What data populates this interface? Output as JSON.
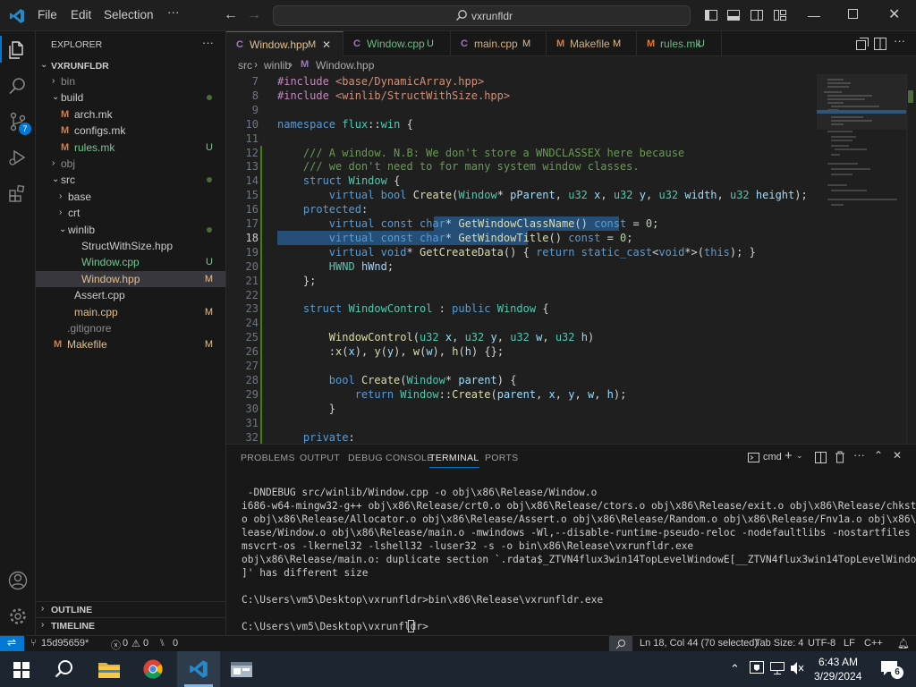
{
  "window": {
    "title": "vxrunfldr"
  },
  "menu": {
    "file": "File",
    "edit": "Edit",
    "selection": "Selection",
    "more": "···"
  },
  "sidebar": {
    "header": "EXPLORER",
    "root": "VXRUNFLDR",
    "items": [
      {
        "label": "bin",
        "status": "",
        "depth": 1,
        "kind": "folder-closed",
        "dot": false
      },
      {
        "label": "build",
        "status": "",
        "depth": 1,
        "kind": "folder-open",
        "dot": true
      },
      {
        "label": "arch.mk",
        "status": "",
        "depth": 2,
        "kind": "makefile",
        "dot": false
      },
      {
        "label": "configs.mk",
        "status": "",
        "depth": 2,
        "kind": "makefile",
        "dot": false
      },
      {
        "label": "rules.mk",
        "status": "U",
        "depth": 2,
        "kind": "makefile",
        "dot": false
      },
      {
        "label": "obj",
        "status": "",
        "depth": 1,
        "kind": "folder-closed",
        "dot": false
      },
      {
        "label": "src",
        "status": "",
        "depth": 1,
        "kind": "folder-open",
        "dot": true
      },
      {
        "label": "base",
        "status": "",
        "depth": 2,
        "kind": "folder-closed",
        "dot": false
      },
      {
        "label": "crt",
        "status": "",
        "depth": 2,
        "kind": "folder-closed",
        "dot": false
      },
      {
        "label": "winlib",
        "status": "",
        "depth": 2,
        "kind": "folder-open",
        "dot": true
      },
      {
        "label": "StructWithSize.hpp",
        "status": "",
        "depth": 3,
        "kind": "file",
        "dot": false
      },
      {
        "label": "Window.cpp",
        "status": "U",
        "depth": 3,
        "kind": "file",
        "dot": false
      },
      {
        "label": "Window.hpp",
        "status": "M",
        "depth": 3,
        "kind": "file",
        "dot": false
      },
      {
        "label": "Assert.cpp",
        "status": "",
        "depth": 2,
        "kind": "file",
        "dot": false
      },
      {
        "label": "main.cpp",
        "status": "M",
        "depth": 2,
        "kind": "file",
        "dot": false
      },
      {
        "label": ".gitignore",
        "status": "",
        "depth": 1,
        "kind": "file",
        "dot": false
      },
      {
        "label": "Makefile",
        "status": "M",
        "depth": 1,
        "kind": "makefile",
        "dot": false
      }
    ],
    "outline": "OUTLINE",
    "timeline": "TIMELINE"
  },
  "tabs": [
    {
      "label": "Window.hpp",
      "status": "M"
    },
    {
      "label": "Window.cpp",
      "status": "U"
    },
    {
      "label": "main.cpp",
      "status": "M"
    },
    {
      "label": "Makefile",
      "status": "M"
    },
    {
      "label": "rules.mk",
      "status": "U"
    }
  ],
  "breadcrumb": {
    "src": "src",
    "winlib": "winlib",
    "file": "Window.hpp"
  },
  "code": [
    {
      "n": "7",
      "t": "#include <base/DynamicArray.hpp>"
    },
    {
      "n": "8",
      "t": "#include <winlib/StructWithSize.hpp>"
    },
    {
      "n": "9",
      "t": ""
    },
    {
      "n": "10",
      "t": "namespace flux::win {"
    },
    {
      "n": "11",
      "t": ""
    },
    {
      "n": "12",
      "t": "    /// A window. N.B: We don't store a WNDCLASSEX here because"
    },
    {
      "n": "13",
      "t": "    /// we don't need to for many system window classes."
    },
    {
      "n": "14",
      "t": "    struct Window {"
    },
    {
      "n": "15",
      "t": "        virtual bool Create(Window* pParent, u32 x, u32 y, u32 width, u32 height);"
    },
    {
      "n": "16",
      "t": "    protected:"
    },
    {
      "n": "17",
      "t": "        virtual const char* GetWindowClassName() const = 0;"
    },
    {
      "n": "18",
      "t": "        virtual const char* GetWindowTitle() const = 0;"
    },
    {
      "n": "19",
      "t": "        virtual void* GetCreateData() { return static_cast<void*>(this); }"
    },
    {
      "n": "20",
      "t": "        HWND hWnd;"
    },
    {
      "n": "21",
      "t": "    };"
    },
    {
      "n": "22",
      "t": ""
    },
    {
      "n": "23",
      "t": "    struct WindowControl : public Window {"
    },
    {
      "n": "24",
      "t": ""
    },
    {
      "n": "25",
      "t": "        WindowControl(u32 x, u32 y, u32 w, u32 h)"
    },
    {
      "n": "26",
      "t": "        :x(x), y(y), w(w), h(h) {};"
    },
    {
      "n": "27",
      "t": ""
    },
    {
      "n": "28",
      "t": "        bool Create(Window* parent) {"
    },
    {
      "n": "29",
      "t": "            return Window::Create(parent, x, y, w, h);"
    },
    {
      "n": "30",
      "t": "        }"
    },
    {
      "n": "31",
      "t": ""
    },
    {
      "n": "32",
      "t": "    private:"
    }
  ],
  "panel": {
    "tabs": [
      "PROBLEMS",
      "OUTPUT",
      "DEBUG CONSOLE",
      "TERMINAL",
      "PORTS"
    ],
    "shell": "cmd",
    "terminal": [
      " -DNDEBUG src/winlib/Window.cpp -o obj\\x86\\Release/Window.o",
      "i686-w64-mingw32-g++ obj\\x86\\Release/crt0.o obj\\x86\\Release/ctors.o obj\\x86\\Release/exit.o obj\\x86\\Release/chkstk.",
      "o obj\\x86\\Release/Allocator.o obj\\x86\\Release/Assert.o obj\\x86\\Release/Random.o obj\\x86\\Release/Fnv1a.o obj\\x86\\Re",
      "lease/Window.o obj\\x86\\Release/main.o -mwindows -Wl,--disable-runtime-pseudo-reloc -nodefaultlibs -nostartfiles -l",
      "msvcrt-os -lkernel32 -lshell32 -luser32 -s -o bin\\x86\\Release\\vxrunfldr.exe",
      "obj\\x86\\Release/main.o: duplicate section `.rdata$_ZTVN4flux3win14TopLevelWindowE[__ZTVN4flux3win14TopLevelWindowE",
      "]' has different size",
      "",
      "C:\\Users\\vm5\\Desktop\\vxrunfldr>bin\\x86\\Release\\vxrunfldr.exe",
      "",
      "C:\\Users\\vm5\\Desktop\\vxrunfldr>"
    ]
  },
  "status": {
    "branch": "15d95659*",
    "errors": "0",
    "warnings": "0",
    "ports": "0",
    "position": "Ln 18, Col 44 (70 selected)",
    "tabsize": "Tab Size: 4",
    "encoding": "UTF-8",
    "eol": "LF",
    "language": "C++"
  },
  "taskbar": {
    "time": "6:43 AM",
    "date": "3/29/2024",
    "notifications": "6"
  },
  "colors": {
    "accent": "#0078d4",
    "modified": "#e2c08d",
    "untracked": "#73c991"
  }
}
